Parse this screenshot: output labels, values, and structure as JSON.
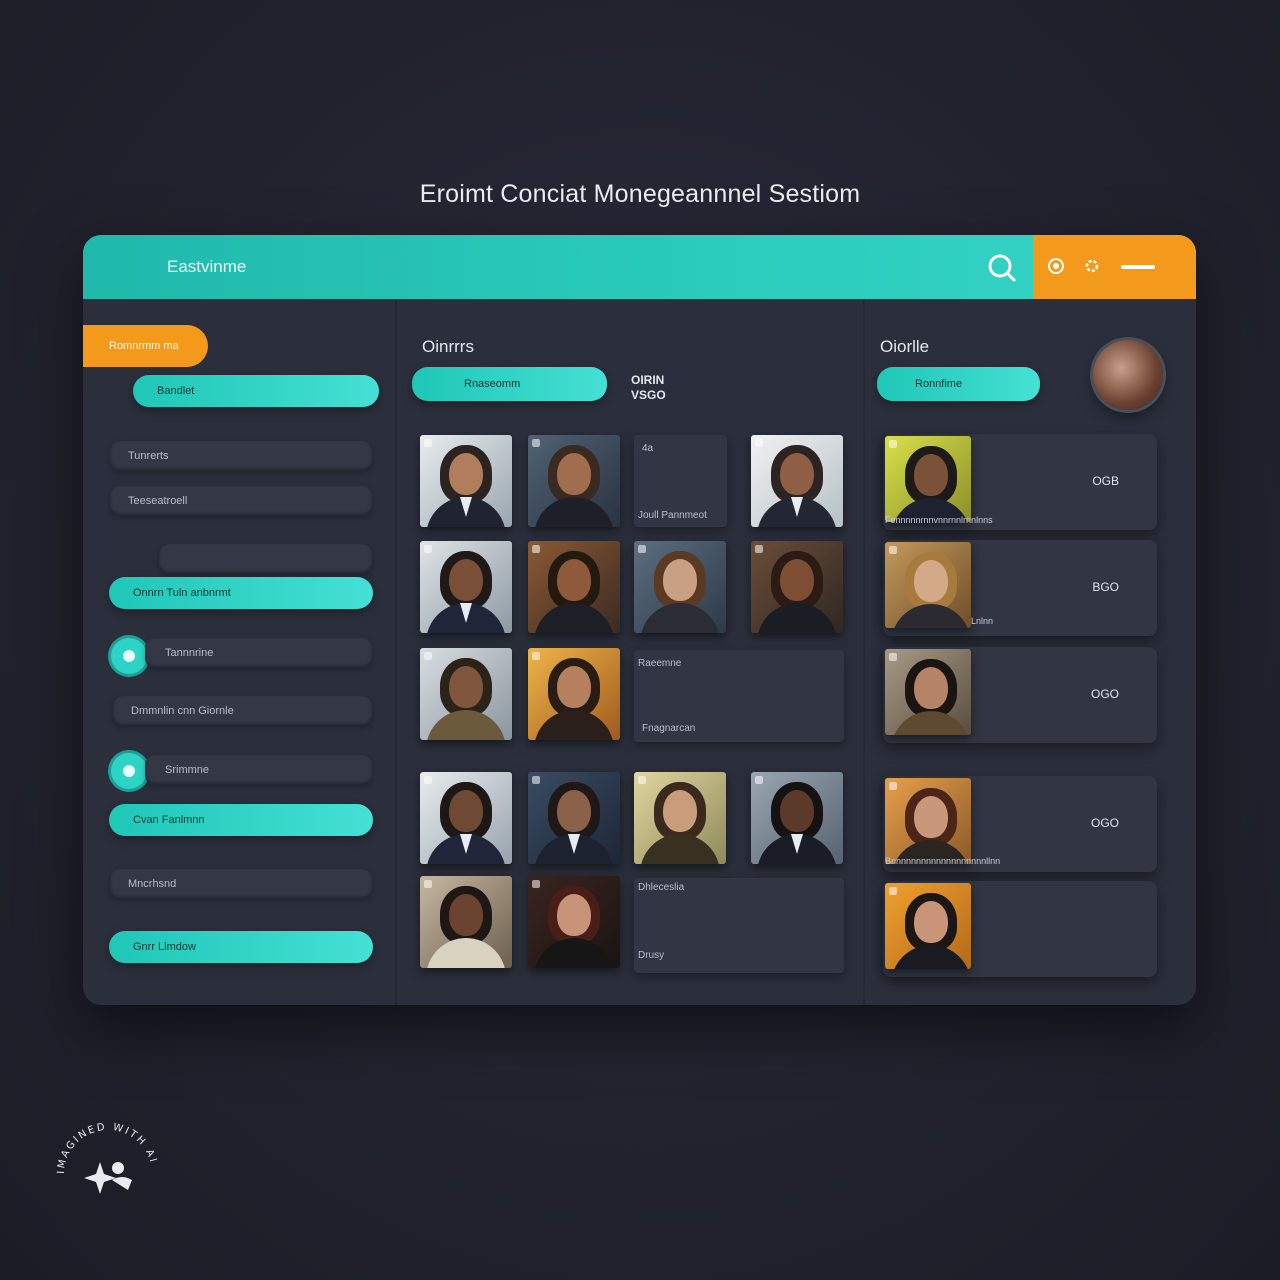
{
  "page": {
    "title": "Eroimt Conciat Monegeannnel Sestiom"
  },
  "header": {
    "brand": "Eastvinme",
    "accent_color": "#f39a1c",
    "primary_color": "#2ccdbd",
    "icons": [
      "search-icon",
      "at-icon",
      "settings-icon",
      "menu-icon"
    ]
  },
  "sidebar": {
    "tab_label": "Romnrmm ma",
    "primary_pill": "Bandlet",
    "fields": [
      "Tunrerts",
      "Teeseatroell",
      "",
      "Tannnrine",
      "Dmmnlin cnn Giornle",
      "Srimmne",
      "Mncrhsnd"
    ],
    "pills": [
      "Onnrn Tuln anbnrmt",
      "Cvan Fanlmnn",
      "Gnrr Llmdow"
    ]
  },
  "middle": {
    "heading": "Oinrrrs",
    "pill": "Rnaseomm",
    "count_label": [
      "OIRIN",
      "VSGO"
    ],
    "placeholders": [
      {
        "top": "4a",
        "bottom": "Joull Pannmeot"
      },
      {
        "top": "Raeemne",
        "bottom": "Fnagnarcan"
      },
      {
        "top": "Dhleceslia",
        "bottom": "Drusy"
      }
    ]
  },
  "right": {
    "heading": "Oiorlle",
    "pill": "Ronnfime",
    "cards": [
      {
        "number": "OGB",
        "caption": "Fennnnnrnnvnnrnnlrnnlnns"
      },
      {
        "number": "BGO",
        "caption": "Lnlnn"
      },
      {
        "number": "OGO",
        "caption": ""
      },
      {
        "number": "OGO",
        "caption": "Bnnnnnnnnnnnnnnnnnnnllnn"
      },
      {
        "number": "",
        "caption": ""
      }
    ]
  },
  "watermark": {
    "text": "IMAGINED WITH AI"
  }
}
